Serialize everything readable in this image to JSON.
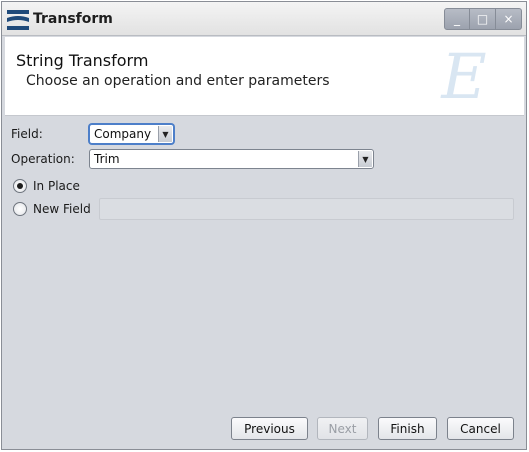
{
  "window": {
    "title": "Transform",
    "controls": {
      "minimize": "_",
      "maximize": "□",
      "close": "×"
    }
  },
  "banner": {
    "title": "String Transform",
    "subtitle": "Choose an operation and enter parameters",
    "logo_icon": "script-e-logo-icon"
  },
  "form": {
    "field_label": "Field:",
    "field_value": "Company",
    "operation_label": "Operation:",
    "operation_value": "Trim",
    "in_place_label": "In Place",
    "in_place_checked": true,
    "new_field_label": "New Field",
    "new_field_checked": false,
    "new_field_value": ""
  },
  "buttons": {
    "previous": "Previous",
    "next": "Next",
    "next_enabled": false,
    "finish": "Finish",
    "cancel": "Cancel"
  },
  "colors": {
    "body_bg": "#d6d9df",
    "banner_bg": "#ffffff",
    "focus": "#4d7fc9",
    "app_icon": "#1f4a7a"
  }
}
